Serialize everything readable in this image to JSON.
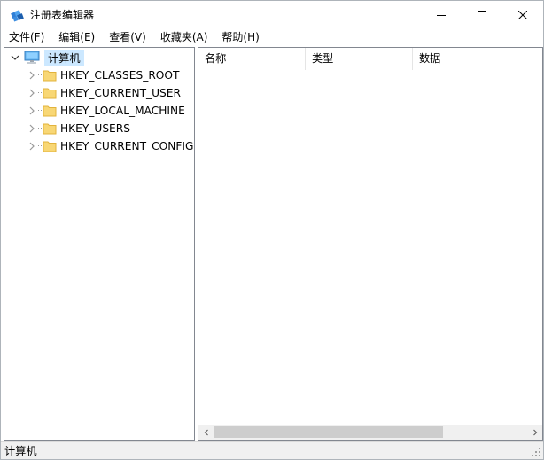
{
  "window": {
    "title": "注册表编辑器",
    "icon": "regedit-icon"
  },
  "menu": {
    "items": [
      {
        "label": "文件(F)"
      },
      {
        "label": "编辑(E)"
      },
      {
        "label": "查看(V)"
      },
      {
        "label": "收藏夹(A)"
      },
      {
        "label": "帮助(H)"
      }
    ]
  },
  "tree": {
    "root": {
      "label": "计算机",
      "icon": "computer-icon",
      "expanded": true,
      "selected": true
    },
    "children": [
      {
        "label": "HKEY_CLASSES_ROOT",
        "icon": "folder-icon"
      },
      {
        "label": "HKEY_CURRENT_USER",
        "icon": "folder-icon"
      },
      {
        "label": "HKEY_LOCAL_MACHINE",
        "icon": "folder-icon"
      },
      {
        "label": "HKEY_USERS",
        "icon": "folder-icon"
      },
      {
        "label": "HKEY_CURRENT_CONFIG",
        "icon": "folder-icon"
      }
    ]
  },
  "list": {
    "columns": [
      {
        "label": "名称"
      },
      {
        "label": "类型"
      },
      {
        "label": "数据"
      }
    ]
  },
  "statusbar": {
    "path": "计算机"
  },
  "colors": {
    "selection": "#cce8ff",
    "folder": "#f8d775",
    "folder_dark": "#e2b33c",
    "border": "#828790",
    "statusbar_bg": "#f0f0f0"
  }
}
